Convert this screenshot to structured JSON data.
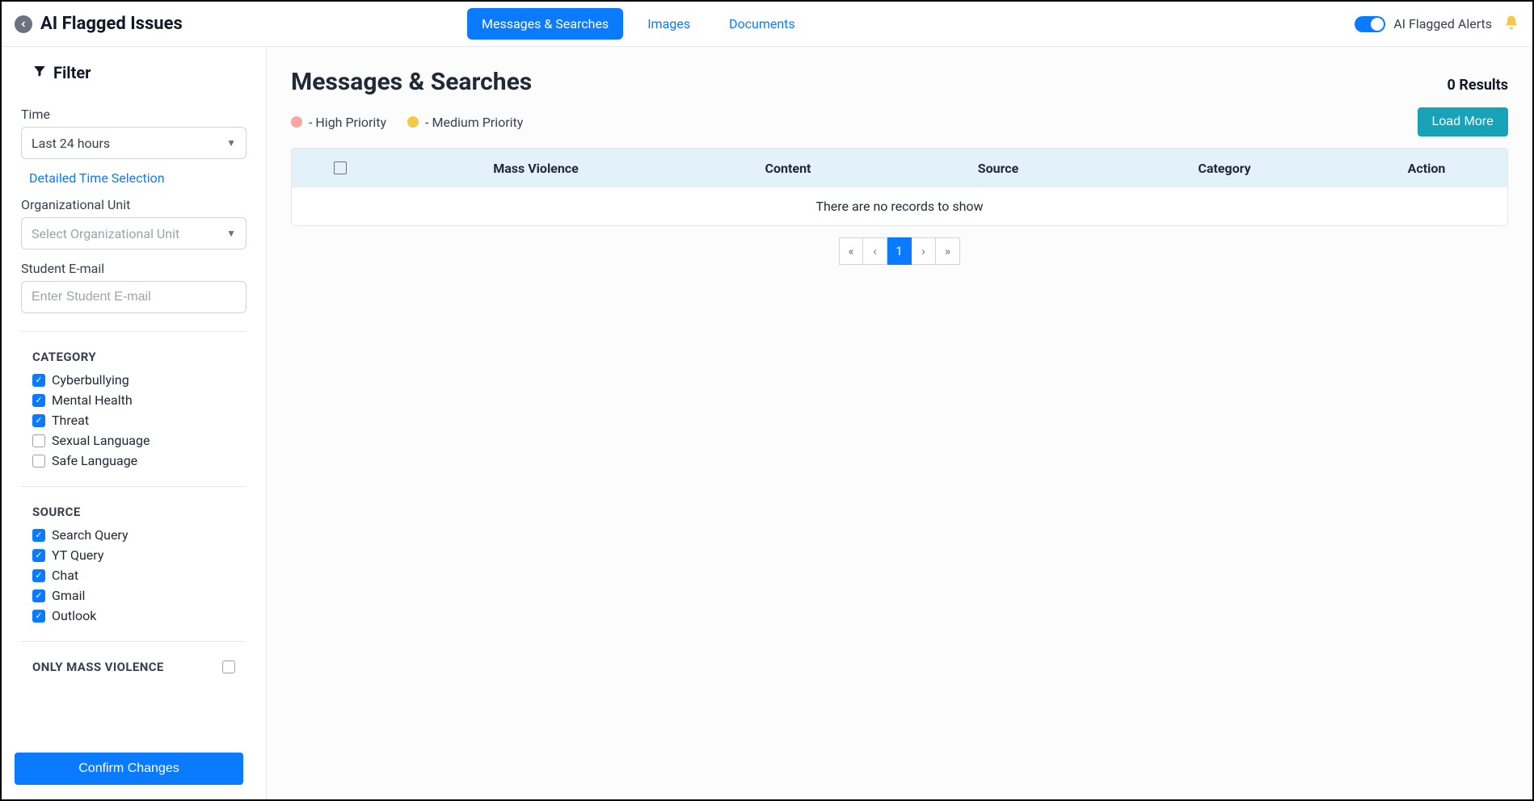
{
  "header": {
    "page_title": "AI Flagged Issues",
    "tabs": [
      {
        "label": "Messages & Searches",
        "active": true
      },
      {
        "label": "Images",
        "active": false
      },
      {
        "label": "Documents",
        "active": false
      }
    ],
    "alerts_toggle_label": "AI Flagged Alerts",
    "alerts_toggle_on": true
  },
  "filter": {
    "title": "Filter",
    "time_label": "Time",
    "time_value": "Last 24 hours",
    "detailed_time_link": "Detailed Time Selection",
    "org_unit_label": "Organizational Unit",
    "org_unit_placeholder": "Select Organizational Unit",
    "student_email_label": "Student E-mail",
    "student_email_placeholder": "Enter Student E-mail",
    "category_head": "CATEGORY",
    "categories": [
      {
        "label": "Cyberbullying",
        "checked": true
      },
      {
        "label": "Mental Health",
        "checked": true
      },
      {
        "label": "Threat",
        "checked": true
      },
      {
        "label": "Sexual Language",
        "checked": false
      },
      {
        "label": "Safe Language",
        "checked": false
      }
    ],
    "source_head": "SOURCE",
    "sources": [
      {
        "label": "Search Query",
        "checked": true
      },
      {
        "label": "YT Query",
        "checked": true
      },
      {
        "label": "Chat",
        "checked": true
      },
      {
        "label": "Gmail",
        "checked": true
      },
      {
        "label": "Outlook",
        "checked": true
      }
    ],
    "only_mass_label": "ONLY MASS VIOLENCE",
    "only_mass_checked": false,
    "confirm_button": "Confirm Changes"
  },
  "main": {
    "title": "Messages & Searches",
    "results_count_text": "0 Results",
    "legend": {
      "high": "- High Priority",
      "medium": "- Medium Priority"
    },
    "load_more": "Load More",
    "columns": [
      "Mass Violence",
      "Content",
      "Source",
      "Category",
      "Action"
    ],
    "empty_text": "There are no records to show",
    "pagination": {
      "first": "«",
      "prev": "‹",
      "current": "1",
      "next": "›",
      "last": "»"
    }
  }
}
